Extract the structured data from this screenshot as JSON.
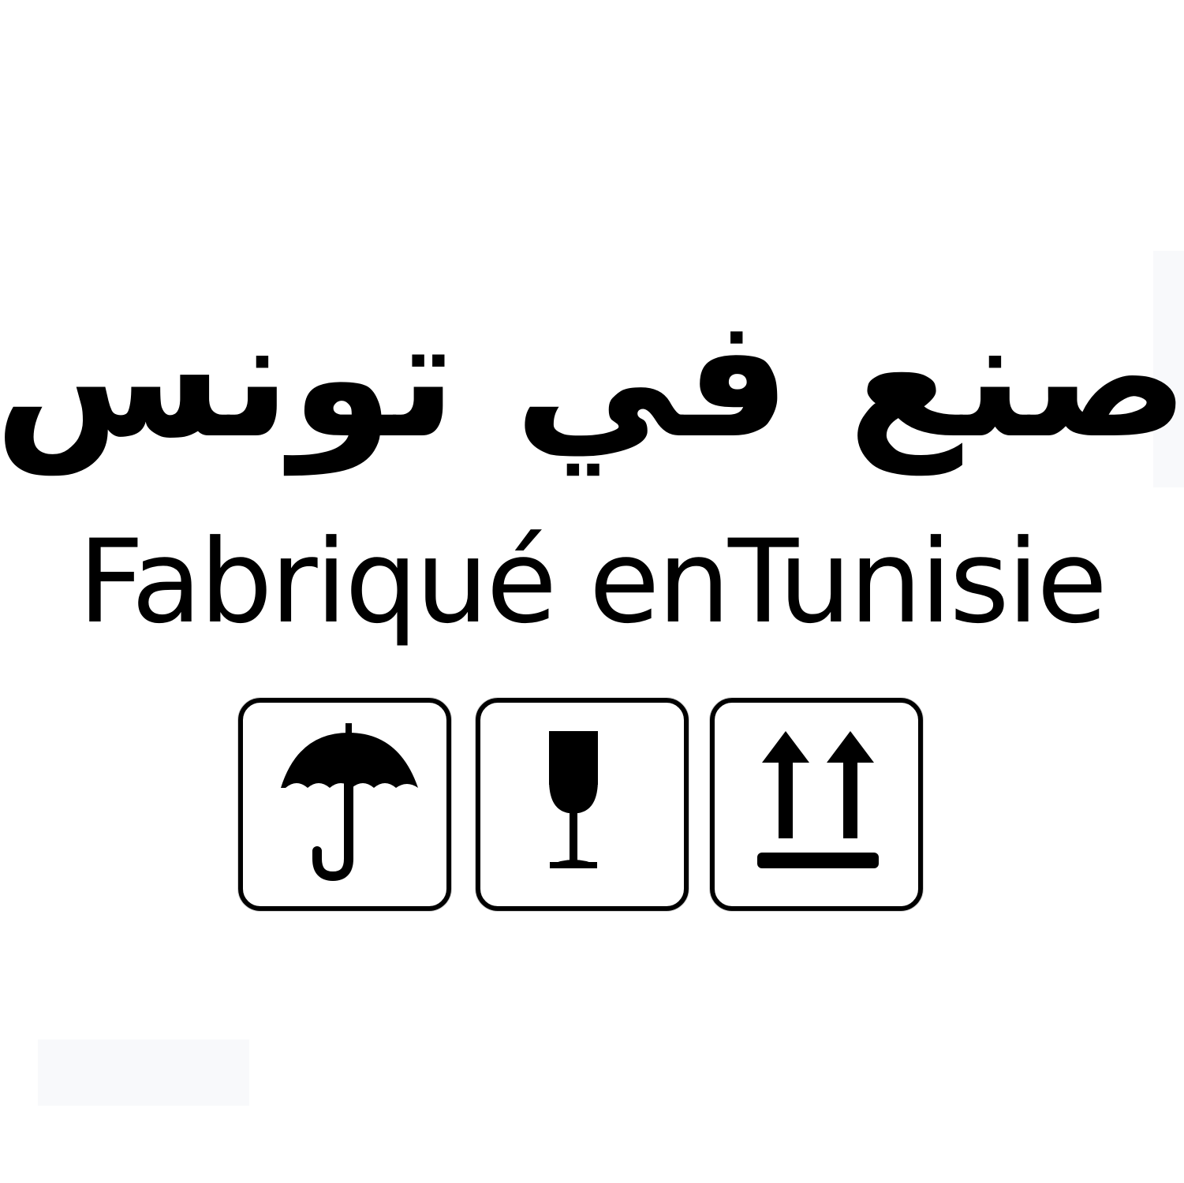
{
  "label": {
    "arabic_text": "صنع في تونس",
    "french_text": "Fabriqué enTunisie"
  },
  "symbols": [
    {
      "icon": "umbrella-icon",
      "meaning": "keep dry"
    },
    {
      "icon": "wine-glass-icon",
      "meaning": "fragile"
    },
    {
      "icon": "this-way-up-icon",
      "meaning": "this way up"
    }
  ],
  "colors": {
    "ink": "#000000",
    "background": "#ffffff"
  }
}
